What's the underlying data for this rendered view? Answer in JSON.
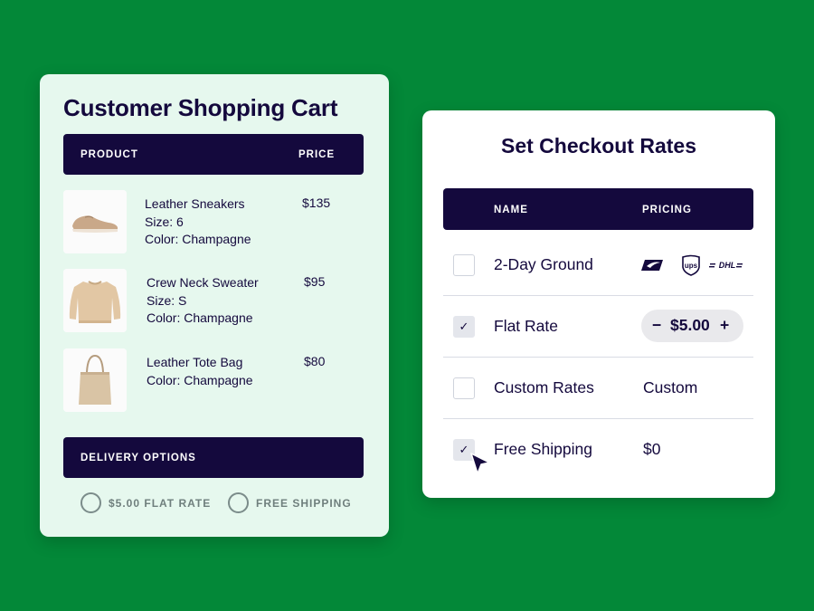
{
  "cart": {
    "title": "Customer Shopping Cart",
    "columns": {
      "product": "PRODUCT",
      "price": "PRICE"
    },
    "items": [
      {
        "name": "Leather Sneakers",
        "size": "Size: 6",
        "color": "Color: Champagne",
        "price": "$135",
        "image": "sneaker-image"
      },
      {
        "name": "Crew Neck Sweater",
        "size": "Size: S",
        "color": "Color: Champagne",
        "price": "$95",
        "image": "sweater-image"
      },
      {
        "name": "Leather Tote Bag",
        "color": "Color: Champagne",
        "price": "$80",
        "image": "tote-bag-image"
      }
    ],
    "delivery": {
      "heading": "DELIVERY OPTIONS",
      "options": [
        "$5.00 FLAT RATE",
        "FREE SHIPPING"
      ]
    }
  },
  "rates": {
    "title": "Set Checkout Rates",
    "columns": {
      "name": "NAME",
      "pricing": "PRICING"
    },
    "rows": [
      {
        "name": "2-Day Ground",
        "checked": false,
        "carriers": [
          "usps-logo",
          "ups-logo",
          "dhl-logo"
        ],
        "carrier_labels": {
          "ups": "ups",
          "dhl": "DHL"
        }
      },
      {
        "name": "Flat Rate",
        "checked": true,
        "stepper": {
          "minus": "−",
          "value": "$5.00",
          "plus": "+"
        }
      },
      {
        "name": "Custom Rates",
        "checked": false,
        "pricing": "Custom"
      },
      {
        "name": "Free Shipping",
        "checked": true,
        "pricing": "$0"
      }
    ],
    "check_glyph": "✓"
  },
  "colors": {
    "background": "#038838",
    "navy": "#14093d",
    "cart_bg": "#e6f8ee"
  }
}
